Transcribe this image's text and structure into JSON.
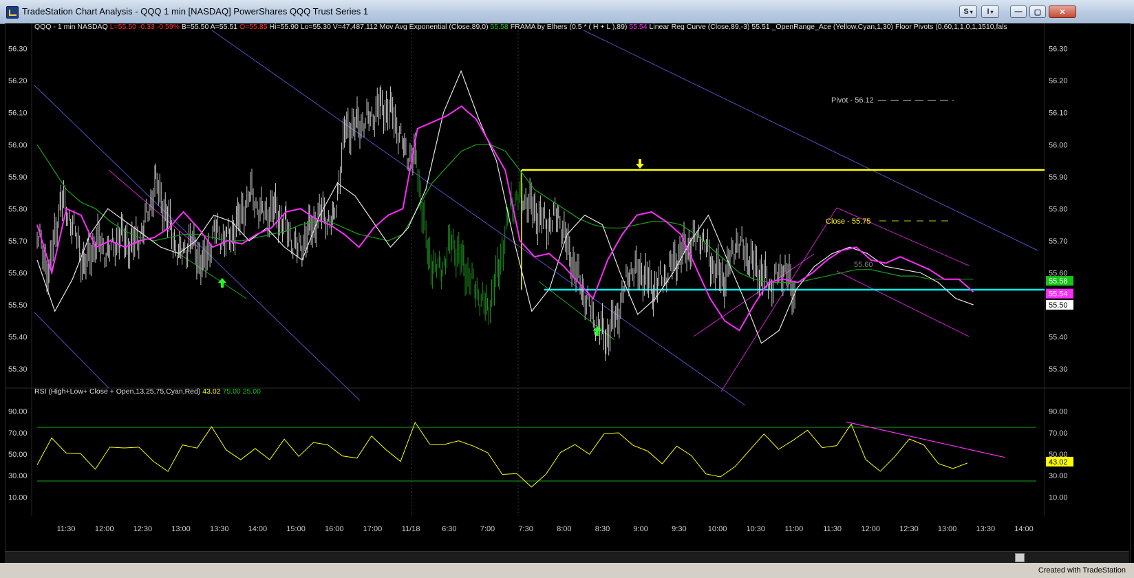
{
  "window": {
    "title": "TradeStation Chart Analysis - QQQ 1 min [NASDAQ] PowerShares QQQ Trust Series 1",
    "btn_s": "S",
    "btn_i": "I",
    "footer": "Created with TradeStation"
  },
  "colors": {
    "background": "#000000",
    "price_bar": "#c8c8c8",
    "ema_green": "#18a418",
    "frama_magenta": "#ff2cff",
    "linreg_white": "#e6e6e6",
    "yellow": "#ffff00",
    "cyan": "#00ffff",
    "trend_blue": "#5050c8",
    "trend_magenta": "#d020d0",
    "trend_green": "#18a418"
  },
  "price_header": [
    {
      "text": "QQQ - 1 min  NASDAQ",
      "color": "#e0e0e0"
    },
    {
      "text": "L=55.50",
      "color": "#ff3030"
    },
    {
      "text": "-0.33",
      "color": "#ff3030"
    },
    {
      "text": "-0.59%",
      "color": "#ff3030"
    },
    {
      "text": "B=55.50",
      "color": "#e0e0e0"
    },
    {
      "text": "A=55.51",
      "color": "#e0e0e0"
    },
    {
      "text": "O=55.85",
      "color": "#ff3030"
    },
    {
      "text": "Hi=55.90",
      "color": "#e0e0e0"
    },
    {
      "text": "Lo=55.30",
      "color": "#e0e0e0"
    },
    {
      "text": "V=47,487,112",
      "color": "#e0e0e0"
    },
    {
      "text": "Mov Avg Exponential (Close,89,0)",
      "color": "#e0e0e0"
    },
    {
      "text": "55.58",
      "color": "#18c418"
    },
    {
      "text": "FRAMA by Elhers (0.5 * ( H + L ),89)",
      "color": "#e0e0e0"
    },
    {
      "text": "55.54",
      "color": "#ff2cff"
    },
    {
      "text": "Linear Reg Curve (Close,89,-3)",
      "color": "#e0e0e0"
    },
    {
      "text": "55.51",
      "color": "#e0e0e0"
    },
    {
      "text": "_OpenRange_Ace (Yellow,Cyan,1,30)",
      "color": "#e0e0e0"
    },
    {
      "text": "Floor Pivots (0,60,1,1,0,1,1510,fals",
      "color": "#e0e0e0"
    }
  ],
  "rsi_header": [
    {
      "text": "RSI (High+Low+ Close + Open,13,25,75,Cyan,Red)",
      "color": "#e0e0e0"
    },
    {
      "text": "43.02",
      "color": "#ffff00"
    },
    {
      "text": "75.00",
      "color": "#18c418"
    },
    {
      "text": "25.00",
      "color": "#18c418"
    }
  ],
  "price_axis": {
    "ticks": [
      "56.30",
      "56.20",
      "56.10",
      "56.00",
      "55.90",
      "55.80",
      "55.70",
      "55.60",
      "55.50",
      "55.40",
      "55.30"
    ],
    "ylim": [
      55.24,
      56.34
    ]
  },
  "rsi_axis": {
    "ticks": [
      "90.00",
      "70.00",
      "50.00",
      "30.00",
      "10.00"
    ],
    "ylim": [
      0,
      100
    ],
    "levels": [
      75,
      25
    ]
  },
  "time_axis": [
    "11:30",
    "12:00",
    "12:30",
    "13:00",
    "13:30",
    "14:00",
    "15:00",
    "16:00",
    "17:00",
    "11/18",
    "6:30",
    "7:00",
    "7:30",
    "8:00",
    "8:30",
    "9:00",
    "9:30",
    "10:00",
    "10:30",
    "11:00",
    "11:30",
    "12:00",
    "12:30",
    "13:00",
    "13:30",
    "14:00"
  ],
  "annotations": {
    "pivot_label": "Pivot - 56.12",
    "close_label": "Close - 55.75",
    "ema_mid_label": "55.60"
  },
  "price_tags": [
    {
      "text": "55.58",
      "bg": "#18c418",
      "fg": "#ffffff",
      "value": 55.575
    },
    {
      "text": "55.54",
      "bg": "#ff2cff",
      "fg": "#ffffff",
      "value": 55.535
    },
    {
      "text": "55.50",
      "bg": "#ffffff",
      "fg": "#000000",
      "value": 55.5
    }
  ],
  "rsi_tag": {
    "text": "43.02",
    "bg": "#ffff00",
    "fg": "#000000",
    "value": 43.02
  },
  "chart_data": {
    "type": "line",
    "x": [
      0,
      16,
      32,
      48,
      64,
      80,
      96,
      112,
      128,
      144,
      160,
      176,
      192,
      208,
      224,
      240,
      256,
      272,
      288,
      304,
      320,
      336,
      352,
      368,
      384,
      400,
      416,
      432,
      448,
      464,
      480,
      496,
      512,
      528,
      544,
      560,
      576,
      592,
      608,
      624,
      640,
      656,
      672,
      688,
      704,
      720,
      736,
      752,
      768,
      784,
      800,
      816,
      832,
      848,
      864,
      880,
      896,
      912,
      928,
      944,
      960,
      976,
      992,
      1008,
      1024,
      1040,
      1056,
      1072,
      1088,
      1104,
      1120,
      1136,
      1152,
      1168,
      1184,
      1200,
      1216,
      1232,
      1248,
      1256
    ],
    "series": [
      {
        "name": "Close",
        "values": [
          55.72,
          55.6,
          55.83,
          55.75,
          55.62,
          55.7,
          55.66,
          55.72,
          55.68,
          55.74,
          55.88,
          55.77,
          55.65,
          55.7,
          55.62,
          55.73,
          55.7,
          55.76,
          55.85,
          55.78,
          55.8,
          55.74,
          55.67,
          55.73,
          55.79,
          55.75,
          56.05,
          56.06,
          56.08,
          56.12,
          56.1,
          55.98,
          55.95,
          55.65,
          55.6,
          55.7,
          55.62,
          55.55,
          55.48,
          55.62,
          55.82,
          55.84,
          55.79,
          55.75,
          55.78,
          55.65,
          55.55,
          55.45,
          55.4,
          55.47,
          55.61,
          55.6,
          55.55,
          55.59,
          55.65,
          55.68,
          55.72,
          55.62,
          55.58,
          55.7,
          55.65,
          55.6,
          55.56,
          55.62,
          55.52
        ]
      },
      {
        "name": "55.58",
        "values": [
          56.0,
          55.93,
          55.86,
          55.82,
          55.8,
          55.76,
          55.73,
          55.71,
          55.7,
          55.71,
          55.72,
          55.72,
          55.71,
          55.7,
          55.7,
          55.71,
          55.72,
          55.73,
          55.75,
          55.76,
          55.76,
          55.74,
          55.72,
          55.71,
          55.7,
          55.72,
          55.8,
          55.88,
          55.93,
          55.98,
          56.0,
          56.0,
          55.98,
          55.92,
          55.86,
          55.83,
          55.8,
          55.77,
          55.75,
          55.74,
          55.74,
          55.75,
          55.76,
          55.76,
          55.75,
          55.72,
          55.68,
          55.64,
          55.6,
          55.58,
          55.57,
          55.57,
          55.57,
          55.58,
          55.59,
          55.6,
          55.61,
          55.61,
          55.6,
          55.59,
          55.59,
          55.58,
          55.58,
          55.58,
          55.58
        ]
      },
      {
        "name": "55.54",
        "values": [
          55.75,
          55.6,
          55.8,
          55.78,
          55.68,
          55.7,
          55.68,
          55.7,
          55.71,
          55.74,
          55.79,
          55.74,
          55.68,
          55.7,
          55.69,
          55.72,
          55.74,
          55.79,
          55.8,
          55.77,
          55.75,
          55.72,
          55.68,
          55.74,
          55.78,
          55.8,
          56.05,
          56.07,
          56.09,
          56.12,
          56.08,
          56.0,
          55.92,
          55.7,
          55.65,
          55.66,
          55.62,
          55.57,
          55.52,
          55.64,
          55.72,
          55.78,
          55.79,
          55.76,
          55.72,
          55.62,
          55.52,
          55.45,
          55.42,
          55.5,
          55.57,
          55.58,
          55.57,
          55.6,
          55.64,
          55.67,
          55.68,
          55.64,
          55.63,
          55.65,
          55.63,
          55.61,
          55.58,
          55.58,
          55.54
        ]
      },
      {
        "name": "55.51",
        "values": [
          55.64,
          55.48,
          55.58,
          55.72,
          55.8,
          55.76,
          55.72,
          55.68,
          55.66,
          55.7,
          55.78,
          55.76,
          55.7,
          55.74,
          55.68,
          55.64,
          55.78,
          55.88,
          55.84,
          55.76,
          55.68,
          55.74,
          55.86,
          56.1,
          56.23,
          56.08,
          55.95,
          55.7,
          55.48,
          55.55,
          55.72,
          55.78,
          55.75,
          55.6,
          55.47,
          55.52,
          55.6,
          55.7,
          55.78,
          55.65,
          55.52,
          55.38,
          55.42,
          55.55,
          55.62,
          55.66,
          55.68,
          55.66,
          55.62,
          55.61,
          55.6,
          55.57,
          55.52,
          55.5
        ]
      },
      {
        "name": "RSI",
        "values": [
          40,
          62,
          55,
          48,
          35,
          60,
          52,
          58,
          45,
          30,
          62,
          55,
          73,
          58,
          42,
          55,
          48,
          60,
          50,
          62,
          55,
          52,
          45,
          65,
          58,
          40,
          80,
          62,
          55,
          65,
          58,
          48,
          35,
          30,
          18,
          35,
          48,
          60,
          52,
          65,
          73,
          58,
          50,
          45,
          55,
          48,
          35,
          25,
          40,
          55,
          65,
          58,
          62,
          70,
          60,
          55,
          78,
          48,
          30,
          50,
          65,
          55,
          45,
          35,
          40
        ]
      }
    ],
    "xlabel": "",
    "ylabel": ""
  }
}
